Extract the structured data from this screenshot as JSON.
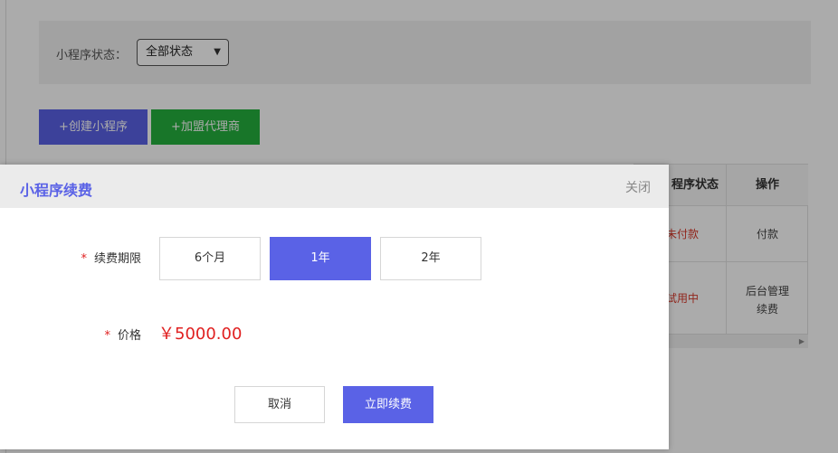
{
  "filter": {
    "label": "小程序状态：",
    "select_value": "全部状态"
  },
  "actions": {
    "create_label": "+创建小程序",
    "join_label": "+加盟代理商"
  },
  "table": {
    "headers": [
      "程序状态",
      "操作"
    ],
    "rows": [
      {
        "status": "未付款",
        "op": "付款"
      },
      {
        "status": "试用中",
        "op_line1": "后台管理",
        "op_line2": "续费"
      }
    ]
  },
  "modal": {
    "title": "小程序续费",
    "close_label": "关闭",
    "period_label": "续费期限",
    "required_mark": "*",
    "period_options": [
      "6个月",
      "1年",
      "2年"
    ],
    "selected_option": "1年",
    "price_label": "价格",
    "price_value": "￥5000.00",
    "cancel_label": "取消",
    "renew_label": "立即续费"
  },
  "colors": {
    "accent": "#5a62e6",
    "green": "#25b03e",
    "red": "#e02020"
  }
}
